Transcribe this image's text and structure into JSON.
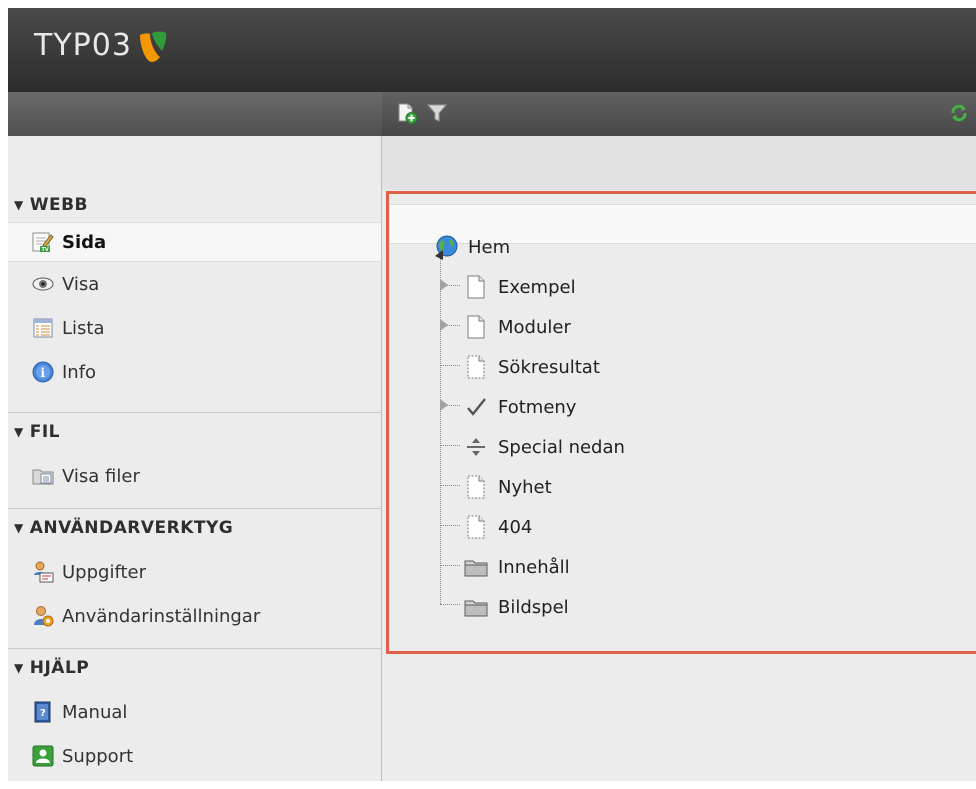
{
  "app": {
    "logo_text": "TYP03",
    "brand_color": "#f49700"
  },
  "toolbar": {
    "new_page_icon": "new-page-icon",
    "filter_icon": "filter-icon",
    "refresh_icon": "refresh-icon"
  },
  "menu": {
    "groups": [
      {
        "label": "WEBB",
        "items": [
          {
            "label": "Sida",
            "icon": "page-module-icon",
            "active": true
          },
          {
            "label": "Visa",
            "icon": "eye-icon"
          },
          {
            "label": "Lista",
            "icon": "list-icon"
          },
          {
            "label": "Info",
            "icon": "info-icon"
          }
        ]
      },
      {
        "label": "FIL",
        "items": [
          {
            "label": "Visa filer",
            "icon": "folder-files-icon"
          }
        ]
      },
      {
        "label": "ANVÄNDARVERKTYG",
        "items": [
          {
            "label": "Uppgifter",
            "icon": "tasks-icon"
          },
          {
            "label": "Användarinställningar",
            "icon": "user-settings-icon"
          }
        ]
      },
      {
        "label": "HJÄLP",
        "items": [
          {
            "label": "Manual",
            "icon": "manual-icon"
          },
          {
            "label": "Support",
            "icon": "support-icon"
          }
        ]
      }
    ]
  },
  "tree": {
    "root": {
      "label": "Hem",
      "icon": "globe-icon"
    },
    "items": [
      {
        "label": "Exempel",
        "icon": "page-icon",
        "expandable": true,
        "hover": true
      },
      {
        "label": "Moduler",
        "icon": "page-icon",
        "expandable": true
      },
      {
        "label": "Sökresultat",
        "icon": "page-hidden-icon"
      },
      {
        "label": "Fotmeny",
        "icon": "checkmark-icon",
        "expandable": true
      },
      {
        "label": "Special nedan",
        "icon": "spacer-icon"
      },
      {
        "label": "Nyhet",
        "icon": "page-hidden-icon"
      },
      {
        "label": "404",
        "icon": "page-hidden-icon"
      },
      {
        "label": "Innehåll",
        "icon": "folder-icon"
      },
      {
        "label": "Bildspel",
        "icon": "folder-icon"
      }
    ]
  },
  "colors": {
    "selection_border": "#e0604a",
    "header_bg": "#333333"
  }
}
